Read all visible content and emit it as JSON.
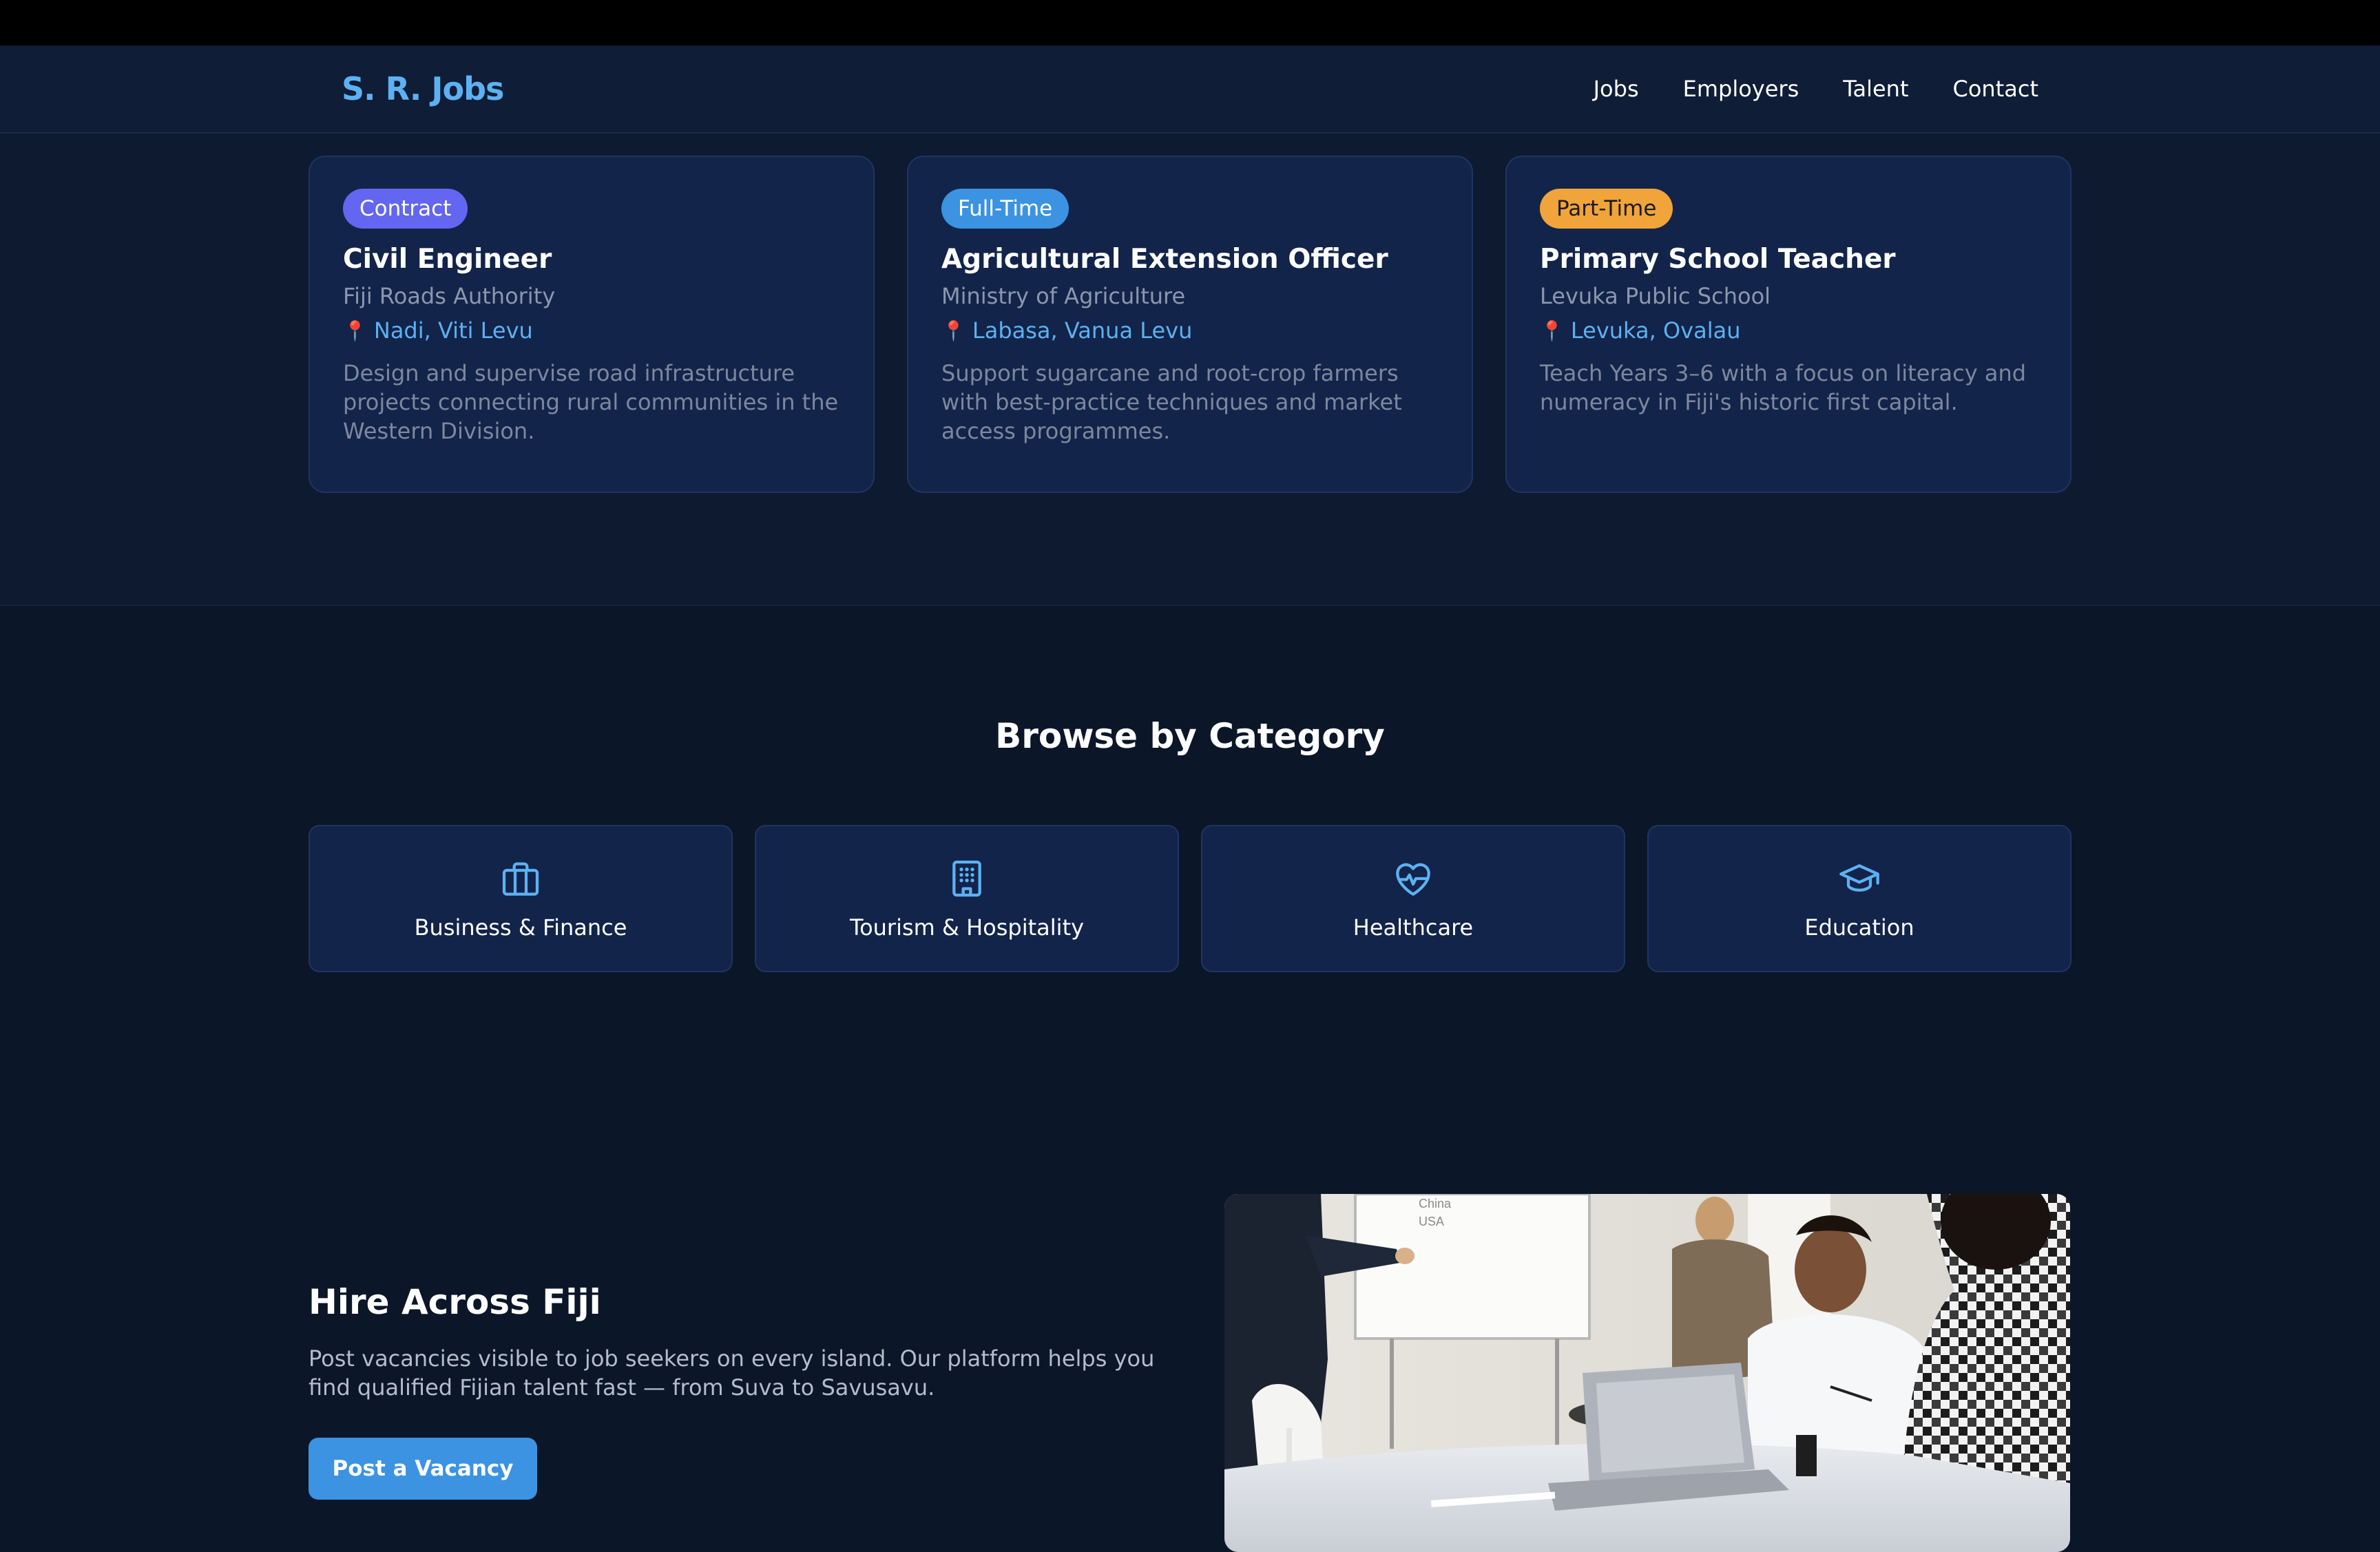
{
  "brand": {
    "name": "S. R. Jobs",
    "accent": "#5db1f2"
  },
  "nav": {
    "links": [
      "Jobs",
      "Employers",
      "Talent",
      "Contact"
    ]
  },
  "jobs": [
    {
      "type": "Contract",
      "title": "Civil Engineer",
      "company": "Fiji Roads Authority",
      "location": "Nadi, Viti Levu",
      "description": "Design and supervise road infrastructure projects connecting rural communities in the Western Division."
    },
    {
      "type": "Full-Time",
      "title": "Agricultural Extension Officer",
      "company": "Ministry of Agriculture",
      "location": "Labasa, Vanua Levu",
      "description": "Support sugarcane and root-crop farmers with best-practice techniques and market access programmes."
    },
    {
      "type": "Part-Time",
      "title": "Primary School Teacher",
      "company": "Levuka Public School",
      "location": "Levuka, Ovalau",
      "description": "Teach Years 3–6 with a focus on literacy and numeracy in Fiji's historic first capital."
    }
  ],
  "categories": {
    "heading": "Browse by Category",
    "items": [
      {
        "label": "Business & Finance",
        "icon": "briefcase-icon"
      },
      {
        "label": "Tourism & Hospitality",
        "icon": "building-icon"
      },
      {
        "label": "Healthcare",
        "icon": "heart-pulse-icon"
      },
      {
        "label": "Education",
        "icon": "graduation-cap-icon"
      }
    ]
  },
  "hire": {
    "title": "Hire Across Fiji",
    "text": "Post vacancies visible to job seekers on every island. Our platform helps you find qualified Fijian talent fast — from Suva to Savusavu.",
    "button": "Post a Vacancy",
    "photo_text": [
      "China",
      "USA"
    ]
  },
  "colors": {
    "page_bg": "#0b1629",
    "card_bg": "#12244a",
    "contract_badge": "#6366f1",
    "fulltime_badge": "#3b93e2",
    "parttime_badge": "#f0a43a",
    "location_pin": "#e04a4a"
  }
}
